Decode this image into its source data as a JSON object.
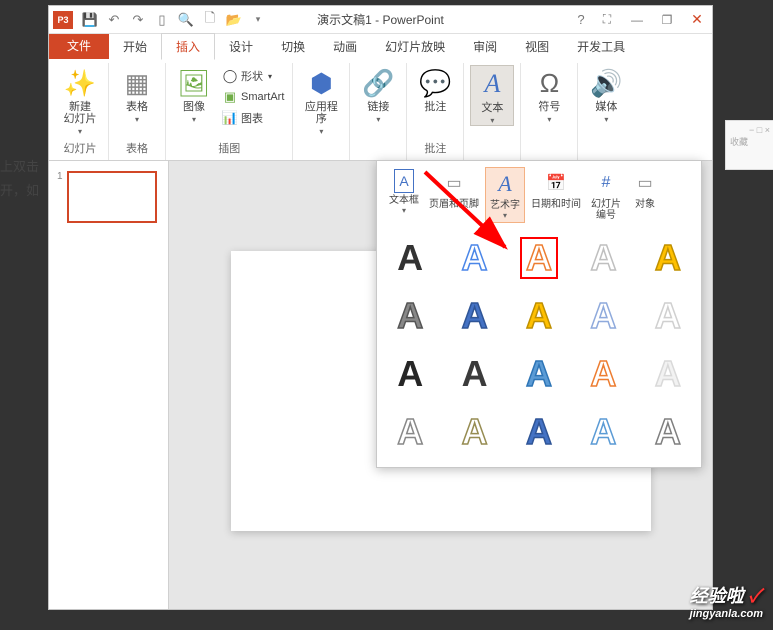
{
  "title": "演示文稿1 - PowerPoint",
  "app_icon_label": "P3",
  "win_controls": {
    "help": "?",
    "display": "⛶",
    "min": "—",
    "restore": "❐",
    "close": "✕"
  },
  "tabs": {
    "file": "文件",
    "items": [
      "开始",
      "插入",
      "设计",
      "切换",
      "动画",
      "幻灯片放映",
      "审阅",
      "视图",
      "开发工具"
    ]
  },
  "ribbon": {
    "new_slide": {
      "label": "新建\n幻灯片",
      "group": "幻灯片"
    },
    "table": {
      "label": "表格",
      "group": "表格"
    },
    "image": {
      "label": "图像"
    },
    "shapes": "形状",
    "smartart": "SmartArt",
    "chart": "图表",
    "illust_group": "插图",
    "app": {
      "label": "应用程\n序",
      "group": ""
    },
    "link": {
      "label": "链接"
    },
    "comment": {
      "label": "批注",
      "group": "批注"
    },
    "text": {
      "label": "文本"
    },
    "symbol": {
      "label": "符号"
    },
    "media": {
      "label": "媒体"
    }
  },
  "popup": {
    "textbox": "文本框",
    "headerfooter": "页眉和页脚",
    "wordart": "艺术字",
    "datetime": "日期和时间",
    "slidenumber": "幻灯片\n编号",
    "object": "对象"
  },
  "slide_number": "1",
  "left_text": {
    "line1": "上双击",
    "line2": "开，如"
  },
  "faded_label": "收藏",
  "watermark": {
    "main": "经验啦",
    "sub": "jingyanla.com",
    "check": "✓"
  },
  "wordart_styles": [
    [
      {
        "fill": "#333",
        "stroke": "none"
      },
      {
        "fill": "none",
        "stroke": "#4a86e8"
      },
      {
        "fill": "none",
        "stroke": "#ed7d31"
      },
      {
        "fill": "none",
        "stroke": "#bfbfbf"
      },
      {
        "fill": "#ffc000",
        "stroke": "#bf9000"
      }
    ],
    [
      {
        "fill": "#888",
        "stroke": "#555"
      },
      {
        "fill": "#4472c4",
        "stroke": "#2f5597"
      },
      {
        "fill": "#ffc000",
        "stroke": "#bf9000"
      },
      {
        "fill": "none",
        "stroke": "#8faadc"
      },
      {
        "fill": "none",
        "stroke": "#d0d0d0"
      }
    ],
    [
      {
        "fill": "#262626",
        "stroke": "none"
      },
      {
        "fill": "#3b3b3b",
        "stroke": "none"
      },
      {
        "fill": "#5b9bd5",
        "stroke": "#2e75b6"
      },
      {
        "fill": "none",
        "stroke": "#ed7d31"
      },
      {
        "fill": "#f2f2f2",
        "stroke": "#d9d9d9"
      }
    ],
    [
      {
        "fill": "none",
        "stroke": "#888"
      },
      {
        "fill": "none",
        "stroke": "#968c52"
      },
      {
        "fill": "#4472c4",
        "stroke": "#2f5597"
      },
      {
        "fill": "none",
        "stroke": "#5b9bd5"
      },
      {
        "fill": "none",
        "stroke": "#7f7f7f"
      }
    ]
  ]
}
